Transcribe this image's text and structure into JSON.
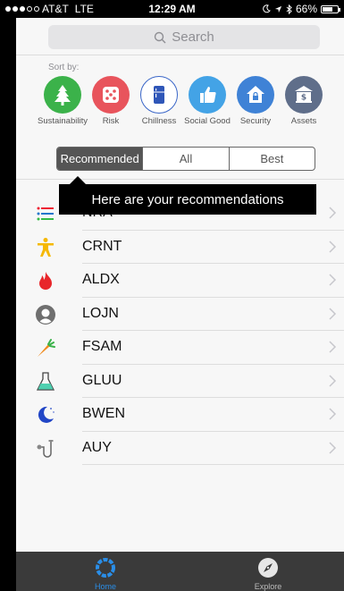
{
  "status": {
    "carrier": "AT&T",
    "network": "LTE",
    "time": "12:29 AM",
    "battery": "66%",
    "battery_level": 0.66
  },
  "search": {
    "placeholder": "Search"
  },
  "sort": {
    "label": "Sort by:",
    "items": [
      {
        "label": "Sustainability",
        "icon": "tree-icon",
        "color": "#3bb24a"
      },
      {
        "label": "Risk",
        "icon": "dice-icon",
        "color": "#e8545c"
      },
      {
        "label": "Chillness",
        "icon": "fridge-icon",
        "color": "#ffffff"
      },
      {
        "label": "Social Good",
        "icon": "thumbs-up-icon",
        "color": "#43a3e6"
      },
      {
        "label": "Security",
        "icon": "house-lock-icon",
        "color": "#3f82d6"
      },
      {
        "label": "Assets",
        "icon": "bank-icon",
        "color": "#5f6e8a"
      }
    ]
  },
  "segmented": {
    "options": [
      "Recommended",
      "All",
      "Best"
    ],
    "selected": "Recommended"
  },
  "tooltip": {
    "text": "Here are your recommendations"
  },
  "list": [
    {
      "label": "NRA",
      "icon": "list-icon"
    },
    {
      "label": "CRNT",
      "icon": "person-icon"
    },
    {
      "label": "ALDX",
      "icon": "flame-icon"
    },
    {
      "label": "LOJN",
      "icon": "profile-silhouette-icon"
    },
    {
      "label": "FSAM",
      "icon": "carrot-icon"
    },
    {
      "label": "GLUU",
      "icon": "flask-icon"
    },
    {
      "label": "BWEN",
      "icon": "moon-icon"
    },
    {
      "label": "AUY",
      "icon": "stethoscope-icon"
    }
  ],
  "tabs": [
    {
      "label": "Home",
      "icon": "home-ring-icon",
      "active": true
    },
    {
      "label": "Explore",
      "icon": "compass-icon",
      "active": false
    }
  ]
}
